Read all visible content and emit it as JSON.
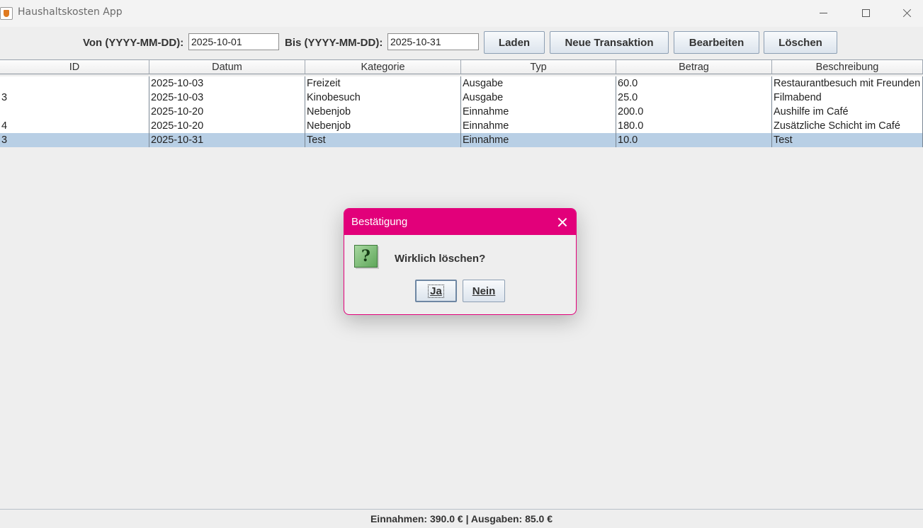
{
  "window": {
    "title": "Haushaltskosten App",
    "icon": "java-cup-icon"
  },
  "toolbar": {
    "von_label": "Von (YYYY-MM-DD):",
    "von_value": "2025-10-01",
    "bis_label": "Bis (YYYY-MM-DD):",
    "bis_value": "2025-10-31",
    "btn_laden": "Laden",
    "btn_neu": "Neue Transaktion",
    "btn_bearbeiten": "Bearbeiten",
    "btn_loeschen": "Löschen"
  },
  "table": {
    "columns": [
      "ID",
      "Datum",
      "Kategorie",
      "Typ",
      "Betrag",
      "Beschreibung"
    ],
    "rows": [
      [
        "",
        "2025-10-03",
        "Freizeit",
        "Ausgabe",
        "60.0",
        "Restaurantbesuch mit Freunden"
      ],
      [
        "3",
        "2025-10-03",
        "Kinobesuch",
        "Ausgabe",
        "25.0",
        "Filmabend"
      ],
      [
        "",
        "2025-10-20",
        "Nebenjob",
        "Einnahme",
        "200.0",
        "Aushilfe im Café"
      ],
      [
        "4",
        "2025-10-20",
        "Nebenjob",
        "Einnahme",
        "180.0",
        "Zusätzliche Schicht im Café"
      ],
      [
        "3",
        "2025-10-31",
        "Test",
        "Einnahme",
        "10.0",
        "Test"
      ]
    ],
    "selected_row": 4
  },
  "status": {
    "text": "Einnahmen: 390.0 € | Ausgaben: 85.0 €"
  },
  "dialog": {
    "title": "Bestätigung",
    "message": "Wirklich löschen?",
    "icon": "question-icon",
    "icon_glyph": "?",
    "btn_yes": "Ja",
    "btn_no": "Nein",
    "accent_color": "#e2007a"
  },
  "colors": {
    "selection": "#b8cfe5",
    "dialog_title": "#e2007a",
    "background": "#eeeeee"
  }
}
